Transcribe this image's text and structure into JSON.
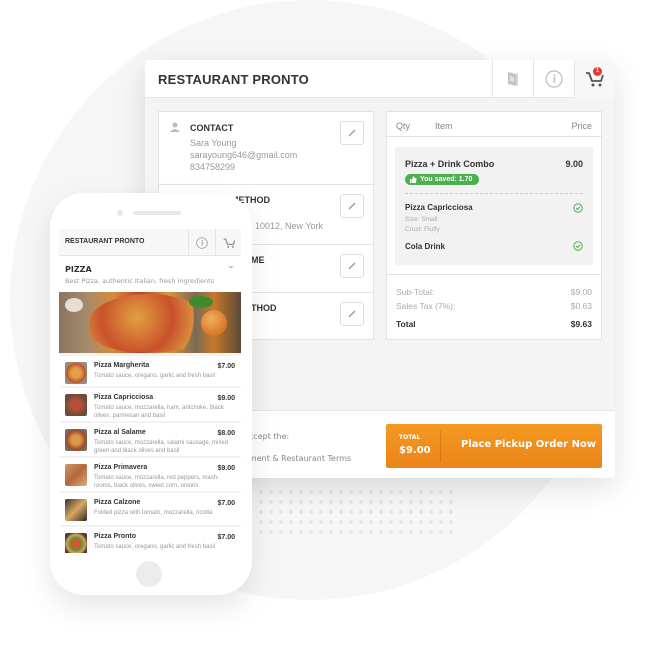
{
  "desktop": {
    "title": "RESTAURANT PRONTO",
    "header_icons": [
      "menu-book-icon",
      "info-icon",
      "cart-icon"
    ],
    "cart_badge": "1",
    "sections": [
      {
        "title": "CONTACT",
        "lines": [
          "Sara Young",
          "sarayoung646@gmail.com",
          "834758299"
        ]
      },
      {
        "title": "METHOD",
        "title_visible_partial": "˘ METHOD",
        "lines": [
          "10012, New York"
        ]
      },
      {
        "title": "ME",
        "lines": []
      },
      {
        "title": "THOD",
        "lines": []
      }
    ],
    "cart": {
      "columns": {
        "qty": "Qty",
        "item": "Item",
        "price": "Price"
      },
      "combo": {
        "name": "Pizza + Drink Combo",
        "price": "9.00",
        "saved_label": "You saved: 1.70",
        "sub_items": [
          {
            "name": "Pizza Capricciosa",
            "details": [
              "Size: Small",
              "Crust: Fluffy"
            ]
          },
          {
            "name": "Cola Drink",
            "details": []
          }
        ]
      },
      "totals": [
        {
          "label": "Sub-Total:",
          "value": "$9.00"
        },
        {
          "label": "Sales Tax (7%):",
          "value": "$0.63"
        },
        {
          "label": "Total",
          "value": "$9.63"
        }
      ]
    },
    "footer": {
      "terms_line1": "accept the:",
      "terms_line2": "ement & Restaurant Terms",
      "order_button": {
        "total_label": "TOTAL",
        "total_value": "$9.00",
        "label": "Place Pickup Order Now"
      }
    },
    "colors": {
      "accent_orange": "#f0901f",
      "saved_green": "#4caf50",
      "badge_red": "#e53935"
    }
  },
  "mobile": {
    "title": "RESTAURANT PRONTO",
    "category": {
      "title": "PIZZA",
      "subtitle": "Best Pizza, authentic Italian, fresh ingredients"
    },
    "items": [
      {
        "name": "Pizza Margherita",
        "price": "$7.00",
        "desc": "Tomato sauce, oregano, garlic and fresh basil"
      },
      {
        "name": "Pizza Capricciosa",
        "price": "$9.00",
        "desc": "Tomato sauce, mozzarella, ham, artichoke, black olives, parmesan and basil"
      },
      {
        "name": "Pizza al Salame",
        "price": "$8.00",
        "desc": "Tomato sauce, mozzarella, salami sausage, mixed green and black olives and basil"
      },
      {
        "name": "Pizza Primavera",
        "price": "$9.00",
        "desc": "Tomato sauce, mozzarella, red peppers, mash-rooms, black olives, sweet corn, onions"
      },
      {
        "name": "Pizza Calzone",
        "price": "$7.00",
        "desc": "Folded pizza with tomato, mozzarella, ricotta"
      },
      {
        "name": "Pizza Pronto",
        "price": "$7.00",
        "desc": "Tomato sauce, oregano, garlic and fresh basil"
      }
    ]
  }
}
